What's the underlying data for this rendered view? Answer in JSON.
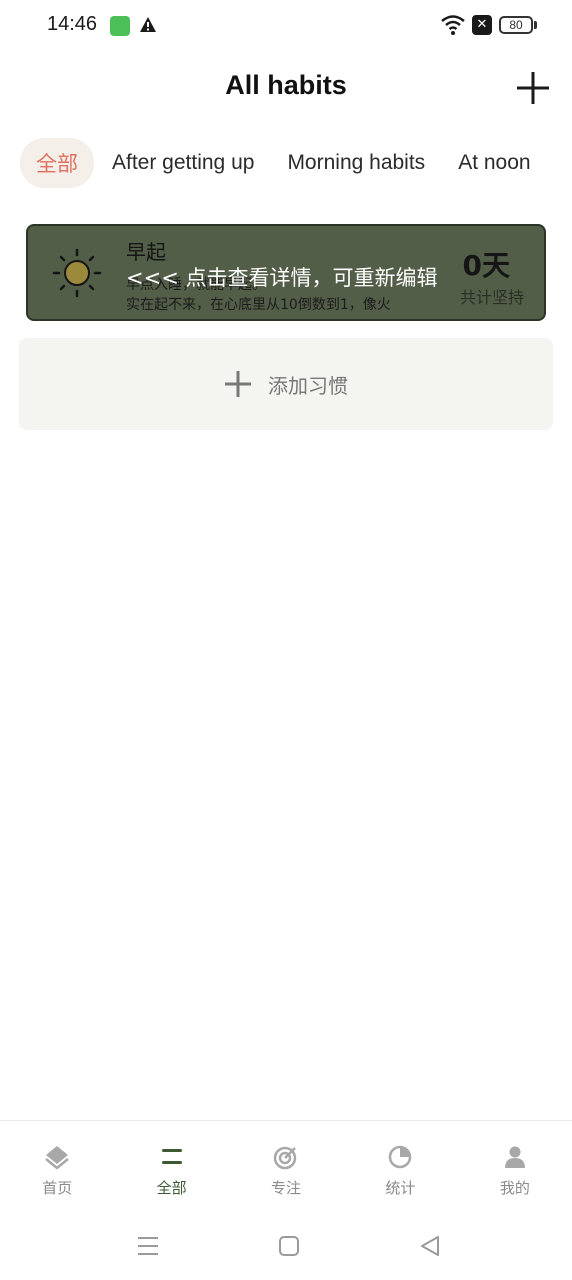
{
  "status_bar": {
    "time": "14:46",
    "battery": "80",
    "icons": [
      "app-icon",
      "warning-icon",
      "wifi-icon",
      "close-box-icon",
      "battery-icon"
    ]
  },
  "header": {
    "title": "All habits",
    "add_icon": "plus-icon"
  },
  "tabs": [
    {
      "label": "全部",
      "active": true
    },
    {
      "label": "After getting up",
      "active": false
    },
    {
      "label": "Morning habits",
      "active": false
    },
    {
      "label": "At noon",
      "active": false
    }
  ],
  "habit": {
    "icon": "sun-icon",
    "name": "早起",
    "desc_line1": "早点入睡，就能早起。",
    "desc_line2": "实在起不来，在心底里从10倒数到1，像火",
    "days": "0天",
    "total_label": "共计坚持",
    "overlay_hint": "<<< 点击查看详情，可重新编辑"
  },
  "add_habit": {
    "label": "添加习惯",
    "icon": "plus-icon"
  },
  "bottom_nav": [
    {
      "label": "首页",
      "icon": "home-icon",
      "active": false
    },
    {
      "label": "全部",
      "icon": "list-icon",
      "active": true
    },
    {
      "label": "专注",
      "icon": "target-icon",
      "active": false
    },
    {
      "label": "统计",
      "icon": "pie-chart-icon",
      "active": false
    },
    {
      "label": "我的",
      "icon": "user-icon",
      "active": false
    }
  ],
  "colors": {
    "card_bg": "#535e48",
    "active_tab_text": "#e07060",
    "active_nav": "#3d5a35"
  }
}
